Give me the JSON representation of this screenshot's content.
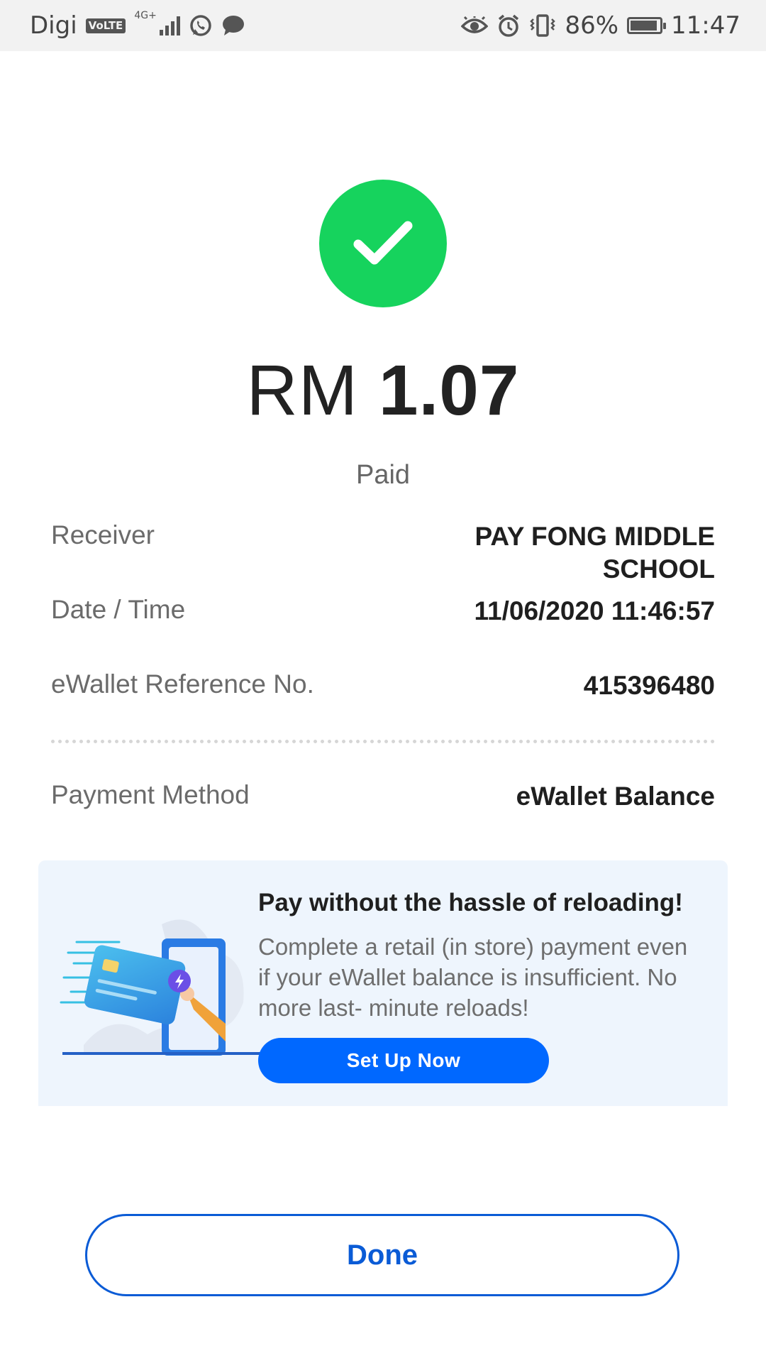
{
  "status_bar": {
    "carrier": "Digi",
    "volte": "VoLTE",
    "network": "4G+",
    "battery_percent": "86%",
    "battery_level": 0.86,
    "time": "11:47",
    "icons": [
      "volte-icon",
      "signal-icon",
      "whatsapp-icon",
      "message-icon",
      "eye-icon",
      "alarm-icon",
      "vibrate-icon",
      "battery-icon"
    ]
  },
  "receipt": {
    "currency": "RM",
    "amount": "1.07",
    "status": "Paid",
    "success_color": "#16d35d",
    "rows": [
      {
        "label": "Receiver",
        "value_line1": "PAY FONG MIDDLE",
        "value_line2": "SCHOOL"
      },
      {
        "label": "Date / Time",
        "value": "11/06/2020 11:46:57"
      },
      {
        "label": "eWallet Reference No.",
        "value": "415396480"
      },
      {
        "label": "Payment Method",
        "value": "eWallet Balance"
      }
    ]
  },
  "promo": {
    "title": "Pay without the hassle of reloading!",
    "description": "Complete a retail (in store) payment even if your eWallet balance is insufficient. No more last- minute reloads!",
    "button_label": "Set Up Now",
    "accent": "#0068ff"
  },
  "footer": {
    "done_label": "Done",
    "accent": "#0a5bd6"
  }
}
